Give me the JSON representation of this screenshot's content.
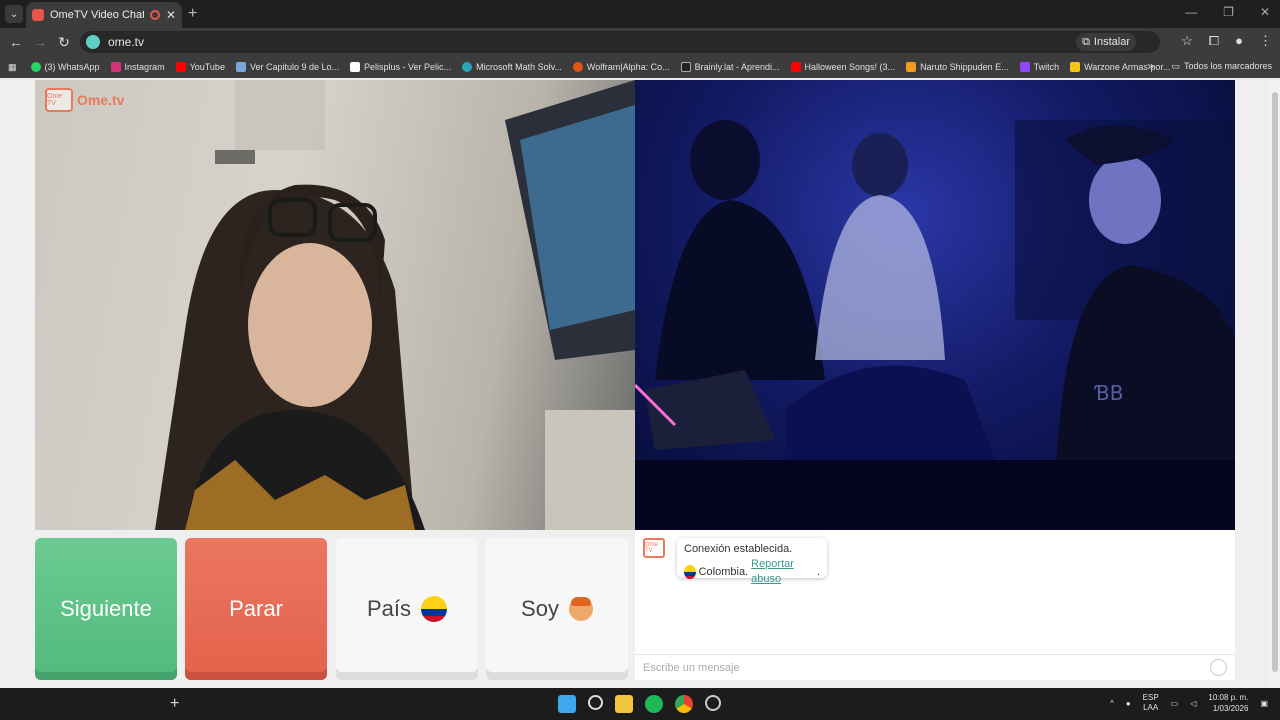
{
  "browser": {
    "tab_title": "OmeTV Video Chat — Ome",
    "url": "ome.tv",
    "install_label": "Instalar",
    "bookmarks": [
      {
        "label": "(3) WhatsApp",
        "color": "#25d366"
      },
      {
        "label": "Instagram",
        "color": "#d6307a"
      },
      {
        "label": "YouTube",
        "color": "#ff0000"
      },
      {
        "label": "Ver Capitulo 9 de Lo...",
        "color": "#7aa7d8"
      },
      {
        "label": "Pelisplus - Ver Pelic...",
        "color": "#ffffff"
      },
      {
        "label": "Microsoft Math Solv...",
        "color": "#2aa6b8"
      },
      {
        "label": "Wolfram|Alpha: Co...",
        "color": "#e5531a"
      },
      {
        "label": "Brainly.lat - Aprendi...",
        "color": "#222222"
      },
      {
        "label": "Halloween Songs! (3...",
        "color": "#ff0000"
      },
      {
        "label": "Naruto Shippuden E...",
        "color": "#f29b1d"
      },
      {
        "label": "Twitch",
        "color": "#9146ff"
      },
      {
        "label": "Warzone Armas por...",
        "color": "#f5c518"
      }
    ],
    "all_bookmarks_label": "Todos los marcadores"
  },
  "app": {
    "logo_text": "Ome.tv",
    "logo_box_text": "Ome TV",
    "buttons": {
      "next": "Siguiente",
      "stop": "Parar",
      "country": "País",
      "gender": "Soy"
    },
    "chat": {
      "system_message": "Conexión establecida.",
      "country": "Colombia.",
      "report_link": "Reportar abuso",
      "report_suffix": ".",
      "input_placeholder": "Escribe un mensaje"
    },
    "colors": {
      "next": "#5ec387",
      "stop": "#e86b54",
      "accent": "#e87a5b",
      "link": "#3a9c8f"
    }
  },
  "taskbar": {
    "lang_line1": "ESP",
    "lang_line2": "LAA",
    "time": "10:08 p. m.",
    "date": "1/03/2026"
  }
}
